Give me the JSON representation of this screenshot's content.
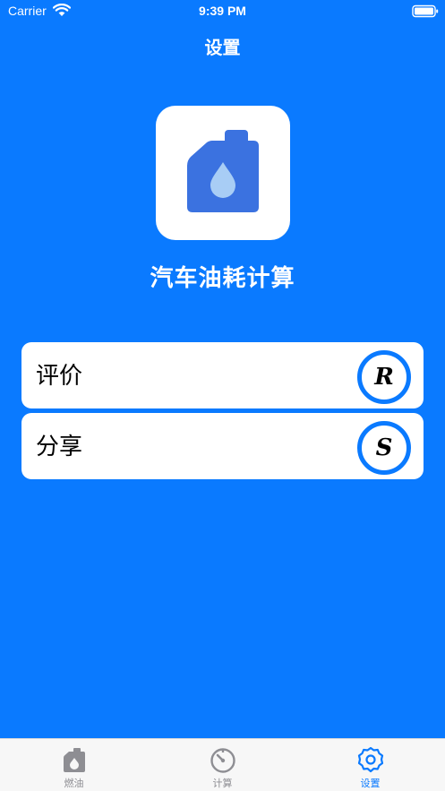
{
  "status_bar": {
    "carrier": "Carrier",
    "time": "9:39 PM"
  },
  "nav": {
    "title": "设置"
  },
  "app": {
    "name": "汽车油耗计算"
  },
  "rows": {
    "rate": {
      "label": "评价",
      "badge": "R"
    },
    "share": {
      "label": "分享",
      "badge": "S"
    }
  },
  "tab_bar": {
    "active": "settings",
    "tabs": [
      {
        "label": "燃油",
        "icon": "fuel-can-icon"
      },
      {
        "label": "计算",
        "icon": "gauge-icon"
      },
      {
        "label": "设置",
        "icon": "gear-icon"
      }
    ]
  },
  "colors": {
    "background": "#0A7AFF",
    "accent": "#0A7AFF",
    "card": "#FFFFFF",
    "icon_blue": "#3B72E0",
    "tab_inactive": "#8E8E93"
  }
}
